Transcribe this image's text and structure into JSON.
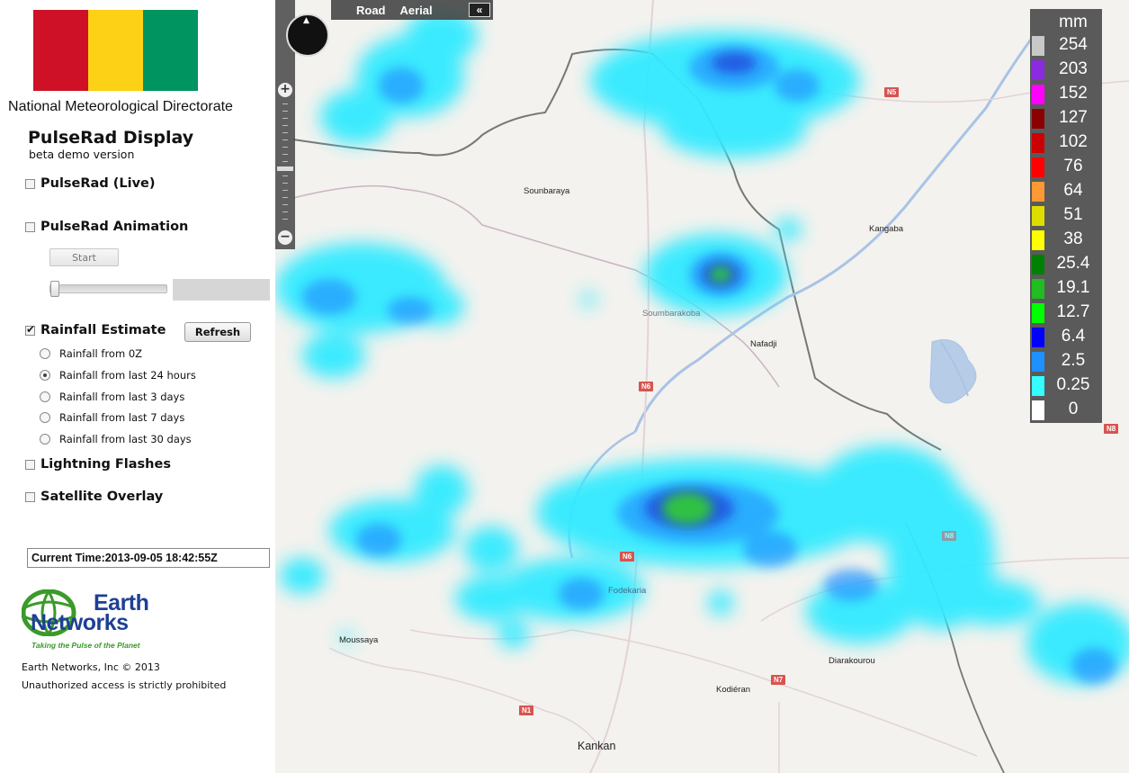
{
  "header": {
    "org_title": "National Meteorological Directorate",
    "app_title": "PulseRad Display",
    "app_subtitle": "beta demo version",
    "flag_colors": [
      "#ce1126",
      "#fcd116",
      "#009460"
    ]
  },
  "controls": {
    "live_label": "PulseRad (Live)",
    "live_checked": false,
    "animation_label": "PulseRad Animation",
    "animation_checked": false,
    "start_label": "Start",
    "rainfall_label": "Rainfall Estimate",
    "rainfall_checked": true,
    "refresh_label": "Refresh",
    "rainfall_options": [
      {
        "label": "Rainfall from 0Z",
        "selected": false
      },
      {
        "label": "Rainfall from last 24 hours",
        "selected": true
      },
      {
        "label": "Rainfall from last 3 days",
        "selected": false
      },
      {
        "label": "Rainfall from last 7 days",
        "selected": false
      },
      {
        "label": "Rainfall from last 30 days",
        "selected": false
      }
    ],
    "lightning_label": "Lightning Flashes",
    "lightning_checked": false,
    "satellite_label": "Satellite Overlay",
    "satellite_checked": false
  },
  "current_time": "Current Time:2013-09-05 18:42:55Z",
  "logo": {
    "line1": "Earth",
    "line2": "Networks",
    "tagline": "Taking the Pulse of the Planet"
  },
  "footer": {
    "copyright": "Earth Networks, Inc © 2013",
    "notice": "Unauthorized access is strictly prohibited"
  },
  "map": {
    "type_road": "Road",
    "type_aerial": "Aerial",
    "collapse_icon": "double-chevron-left-icon",
    "places": [
      "Sounbaraya",
      "Kangaba",
      "Soumbarakoba",
      "Nafadji",
      "Fodekaria",
      "Moussaya",
      "Diarakourou",
      "Kodiéran",
      "Kankan"
    ],
    "roads": [
      "N5",
      "N6",
      "N6",
      "N7",
      "N1",
      "N8",
      "N8"
    ]
  },
  "legend": {
    "unit": "mm",
    "entries": [
      {
        "label": "254",
        "color": "#c8c8c8"
      },
      {
        "label": "203",
        "color": "#8a2be2"
      },
      {
        "label": "152",
        "color": "#ff00ff"
      },
      {
        "label": "127",
        "color": "#8b0000"
      },
      {
        "label": "102",
        "color": "#cc0000"
      },
      {
        "label": "76",
        "color": "#ff0000"
      },
      {
        "label": "64",
        "color": "#ff9933"
      },
      {
        "label": "51",
        "color": "#dddd00"
      },
      {
        "label": "38",
        "color": "#ffff00"
      },
      {
        "label": "25.4",
        "color": "#008000"
      },
      {
        "label": "19.1",
        "color": "#22bb22"
      },
      {
        "label": "12.7",
        "color": "#00ff00"
      },
      {
        "label": "6.4",
        "color": "#0000ff"
      },
      {
        "label": "2.5",
        "color": "#1e90ff"
      },
      {
        "label": "0.25",
        "color": "#33ffff"
      },
      {
        "label": "0",
        "color": "#ffffff"
      }
    ]
  }
}
